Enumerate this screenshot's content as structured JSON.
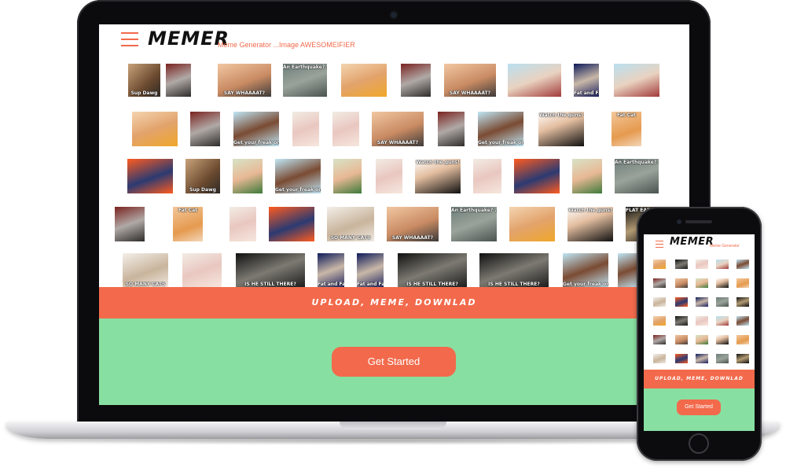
{
  "laptop": {
    "logo": "MEMER",
    "tagline": "Meme Generator ...Image AWESOMEIFIER",
    "banner": "UPLOAD, MEME, DOWNLAD",
    "cta_label": "Get Started"
  },
  "phone": {
    "logo": "MEMER",
    "tagline": "Meme Generator",
    "banner": "UPLOAD, MEME, DOWNLAD",
    "cta_label": "Get Started"
  },
  "meme_captions": {
    "sup_dawg": "Sup Dawg",
    "say_whaaat": "SAY WHAAAAT?",
    "get_your_freak_on": "Get your freak on...",
    "watch_the_guns": "Watch the guns!",
    "fat_cat": "Fat Cat",
    "flat_earth": "FLAT EARTHERS BE LIKE",
    "is_he_still_there": "IS HE STILL THERE?",
    "fat_and_fatter": "Fat and Fatter",
    "so_many_cats": "SO MANY CATS",
    "an_earthquake": "An Earthquake? ...an Earthquake",
    "blank": ""
  },
  "theme": {
    "accent": "#f26a4b",
    "green": "#88dfa2"
  }
}
